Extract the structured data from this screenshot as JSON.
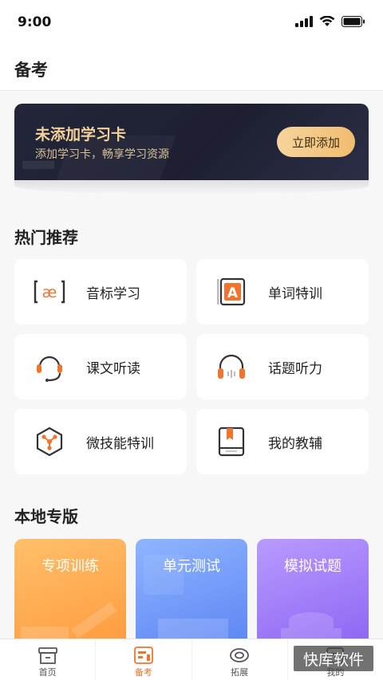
{
  "status_bar": {
    "time": "9:00"
  },
  "header": {
    "title": "备考"
  },
  "banner": {
    "title": "未添加学习卡",
    "subtitle": "添加学习卡，畅享学习资源",
    "button_label": "立即添加"
  },
  "hot": {
    "title": "热门推荐",
    "items": [
      {
        "label": "音标学习",
        "icon": "phonetic-icon"
      },
      {
        "label": "单词特训",
        "icon": "word-card-icon"
      },
      {
        "label": "课文听读",
        "icon": "headset-mic-icon"
      },
      {
        "label": "话题听力",
        "icon": "headphones-icon"
      },
      {
        "label": "微技能特训",
        "icon": "hexagon-skill-icon"
      },
      {
        "label": "我的教辅",
        "icon": "book-icon"
      }
    ]
  },
  "local": {
    "title": "本地专版",
    "tiles": [
      {
        "label": "专项训练"
      },
      {
        "label": "单元测试"
      },
      {
        "label": "模拟试题"
      }
    ]
  },
  "tabbar": {
    "items": [
      {
        "label": "首页",
        "icon": "home-icon"
      },
      {
        "label": "备考",
        "icon": "exam-prep-icon",
        "active": true
      },
      {
        "label": "拓展",
        "icon": "expand-icon"
      },
      {
        "label": "我的",
        "icon": "profile-icon"
      }
    ]
  },
  "watermark": {
    "text": "快库软件"
  },
  "colors": {
    "accent": "#f0742d",
    "banner_bg": "#1d1f31",
    "banner_text": "#f3d199"
  }
}
